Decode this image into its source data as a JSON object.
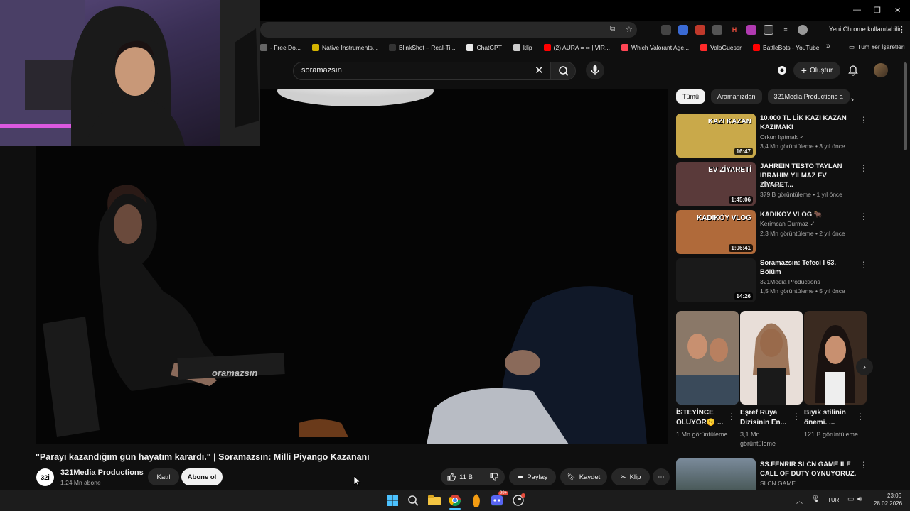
{
  "chrome": {
    "profile_label": "Yeni Chrome kullanılabilir",
    "bookmarks": [
      {
        "label": "- Free Do...",
        "color": "#666666"
      },
      {
        "label": "Native Instruments...",
        "color": "#d4b300"
      },
      {
        "label": "BlinkShot – Real-Ti...",
        "color": "#333333"
      },
      {
        "label": "ChatGPT",
        "color": "#e8e8e8"
      },
      {
        "label": "klip",
        "color": "#cccccc"
      },
      {
        "label": "(2) AURA = ∞ | VIR...",
        "color": "#ff0000"
      },
      {
        "label": "Which Valorant Age...",
        "color": "#ff4655"
      },
      {
        "label": "ValoGuessr",
        "color": "#ff2a2a"
      },
      {
        "label": "BattleBots - YouTube",
        "color": "#ff0000"
      }
    ],
    "all_bookmarks": "Tüm Yer İşaretleri",
    "more_bookmarks": "»"
  },
  "youtube": {
    "search_value": "soramazsın",
    "create_label": "Oluştur"
  },
  "video": {
    "title": "\"Parayı kazandığım gün hayatım karardı.\" | Soramazsın: Milli Piyango Kazananı",
    "channel_logo": "32İ",
    "channel_name": "321Media Productions",
    "subscribers": "1,24 Mn abone",
    "join_label": "Katıl",
    "subscribe_label": "Abone ol",
    "likes": "11 B",
    "share_label": "Paylaş",
    "save_label": "Kaydet",
    "clip_label": "Klip",
    "watermark": "oramazsın"
  },
  "sidebar": {
    "chips": [
      "Tümü",
      "Aramanızdan",
      "321Media Productions a"
    ],
    "recommendations": [
      {
        "title": "10.000 TL LİK KAZI KAZAN KAZIMAK!",
        "channel": "Orkun Işıtmak ✓",
        "meta": "3,4 Mn görüntüleme • 3 yıl önce",
        "duration": "16:47",
        "thumb_text": "KAZI KAZAN",
        "thumb_color": "#c9a94a"
      },
      {
        "title": "JAHREİN TESTO TAYLAN İBRAHİM YILMAZ EV ZİYARET...",
        "channel": "Jahistan",
        "meta": "379 B görüntüleme • 1 yıl önce",
        "duration": "1:45:06",
        "thumb_text": "EV ZİYARETİ",
        "thumb_color": "#5a3a3a"
      },
      {
        "title": "KADIKÖY VLOG 🐂",
        "channel": "Kerimcan Durmaz ✓",
        "meta": "2,3 Mn görüntüleme • 2 yıl önce",
        "duration": "1:06:41",
        "thumb_text": "KADIKÖY VLOG",
        "thumb_color": "#b06a3a"
      },
      {
        "title": "Soramazsın: Tefeci I 63. Bölüm",
        "channel": "321Media Productions",
        "meta": "1,5 Mn görüntüleme • 5 yıl önce",
        "duration": "14:26",
        "thumb_text": "",
        "thumb_color": "#1a1a1a"
      }
    ],
    "shorts": [
      {
        "title": "İSTEYİNCE OLUYOR🤫 ...",
        "views": "1 Mn görüntüleme",
        "color": "#8a7868"
      },
      {
        "title": "Eşref Rüya Dizisinin En...",
        "views": "3,1 Mn görüntüleme",
        "color": "#d8c8c0"
      },
      {
        "title": "Bıyık stilinin önemi. ...",
        "views": "121 B görüntüleme",
        "color": "#4a3a30"
      }
    ],
    "bottom_rec": {
      "title": "SS.FENRIR SLCN GAME İLE CALL OF DUTY OYNUYORUZ.",
      "channel": "SLCN GAME"
    }
  },
  "taskbar": {
    "lang": "TUR",
    "time": "23:06",
    "date": "28.02.2026",
    "discord_badge": "99+"
  }
}
